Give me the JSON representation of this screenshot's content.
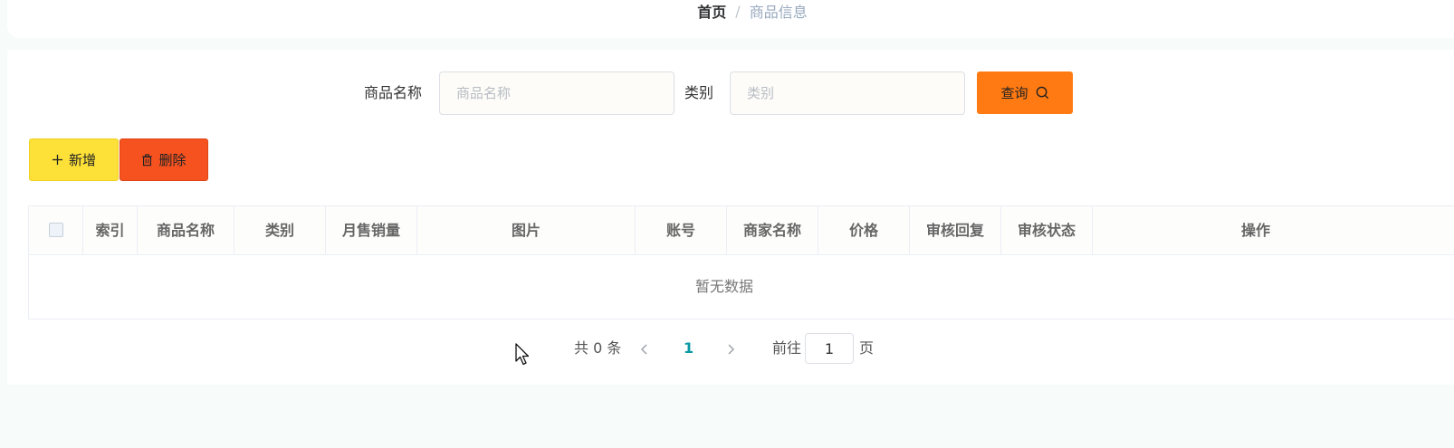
{
  "breadcrumb": {
    "home": "首页",
    "separator": "/",
    "current": "商品信息"
  },
  "search": {
    "name_label": "商品名称",
    "name_placeholder": "商品名称",
    "name_value": "",
    "category_label": "类别",
    "category_placeholder": "类别",
    "category_value": "",
    "query_label": "查询"
  },
  "toolbar": {
    "add_label": "新增",
    "delete_label": "删除"
  },
  "table": {
    "columns": [
      "索引",
      "商品名称",
      "类别",
      "月售销量",
      "图片",
      "账号",
      "商家名称",
      "价格",
      "审核回复",
      "审核状态",
      "操作"
    ],
    "empty_text": "暂无数据"
  },
  "pagination": {
    "total_text": "共 0 条",
    "current_page": "1",
    "goto_label": "前往",
    "goto_value": "1",
    "page_suffix": "页"
  },
  "colors": {
    "query": "#ff7a12",
    "add": "#fde038",
    "delete": "#f5521f",
    "active_page": "#0b9aa5"
  }
}
